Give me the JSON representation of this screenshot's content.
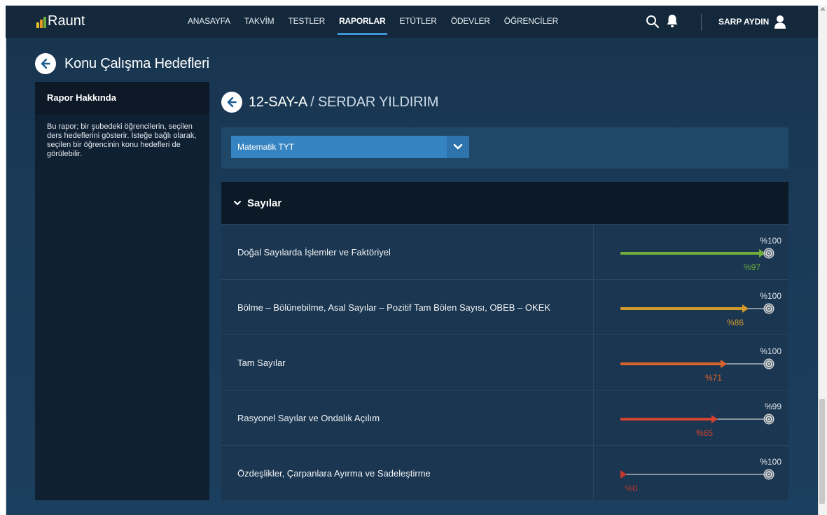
{
  "app": {
    "name": "Raunt"
  },
  "nav": {
    "items": [
      {
        "label": "ANASAYFA"
      },
      {
        "label": "TAKVİM"
      },
      {
        "label": "TESTLER"
      },
      {
        "label": "RAPORLAR",
        "active": true
      },
      {
        "label": "ETÜTLER"
      },
      {
        "label": "ÖDEVLER"
      },
      {
        "label": "ÖĞRENCİLER"
      }
    ],
    "user_name": "SARP AYDIN",
    "icons": [
      "search-icon",
      "bell-icon",
      "user-icon"
    ]
  },
  "page": {
    "title": "Konu Çalışma Hedefleri"
  },
  "about": {
    "title": "Rapor Hakkında",
    "text": "Bu rapor; bir şubedeki öğrencilerin, seçilen ders hedeflerini gösterir. İsteğe bağlı olarak, seçilen bir öğrencinin konu hedefleri de görülebilir."
  },
  "main": {
    "class_name": "12-SAY-A",
    "separator": " / ",
    "student_name": "SERDAR YILDIRIM",
    "subject_select": {
      "value": "Matematik TYT"
    }
  },
  "section": {
    "title": "Sayılar",
    "topics": [
      {
        "name": "Doğal Sayılarda İşlemler ve Faktöriyel",
        "target_label": "%100",
        "actual_label": "%97",
        "actual": 97,
        "target": 100,
        "color": "#6fae3a"
      },
      {
        "name": "Bölme – Bölünebilme, Asal Sayılar – Pozitif Tam Bölen Sayısı, OBEB – OKEK",
        "target_label": "%100",
        "actual_label": "%86",
        "actual": 86,
        "target": 100,
        "color": "#d29a2a"
      },
      {
        "name": "Tam Sayılar",
        "target_label": "%100",
        "actual_label": "%71",
        "actual": 71,
        "target": 100,
        "color": "#d9632d"
      },
      {
        "name": "Rasyonel Sayılar ve Ondalık Açılım",
        "target_label": "%99",
        "actual_label": "%65",
        "actual": 65,
        "target": 99,
        "color": "#d4432f"
      },
      {
        "name": "Özdeşlikler, Çarpanlara Ayırma ve Sadeleştirme",
        "target_label": "%100",
        "actual_label": "%0",
        "actual": 0,
        "target": 100,
        "color": "#c8352a"
      }
    ]
  },
  "colors": {
    "nav_bg": "#14283b",
    "accent": "#3e96d6",
    "select_bg": "#3583c0",
    "panel_dark": "#0c1a28"
  }
}
